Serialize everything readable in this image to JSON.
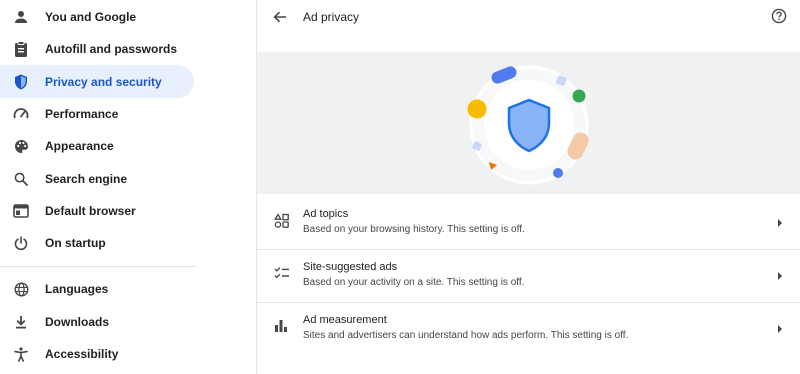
{
  "sidebar": {
    "items": [
      {
        "label": "You and Google",
        "icon": "person-icon",
        "active": false
      },
      {
        "label": "Autofill and passwords",
        "icon": "clipboard-icon",
        "active": false
      },
      {
        "label": "Privacy and security",
        "icon": "shield-icon",
        "active": true
      },
      {
        "label": "Performance",
        "icon": "speedometer-icon",
        "active": false
      },
      {
        "label": "Appearance",
        "icon": "palette-icon",
        "active": false
      },
      {
        "label": "Search engine",
        "icon": "search-icon",
        "active": false
      },
      {
        "label": "Default browser",
        "icon": "browser-window-icon",
        "active": false
      },
      {
        "label": "On startup",
        "icon": "power-icon",
        "active": false
      },
      {
        "label": "Languages",
        "icon": "globe-icon",
        "active": false
      },
      {
        "label": "Downloads",
        "icon": "download-icon",
        "active": false
      },
      {
        "label": "Accessibility",
        "icon": "accessibility-icon",
        "active": false
      }
    ]
  },
  "header": {
    "title": "Ad privacy"
  },
  "rows": [
    {
      "title": "Ad topics",
      "subtitle": "Based on your browsing history. This setting is off.",
      "icon": "ad-topics-icon"
    },
    {
      "title": "Site-suggested ads",
      "subtitle": "Based on your activity on a site. This setting is off.",
      "icon": "checklist-icon"
    },
    {
      "title": "Ad measurement",
      "subtitle": "Sites and advertisers can understand how ads perform. This setting is off.",
      "icon": "bar-chart-icon"
    }
  ],
  "colors": {
    "accent": "#1a56c7",
    "active_bg": "#e8f0fe",
    "hero_bg": "#f0f1f3",
    "shield_fill": "#8ab4f8",
    "shield_stroke": "#1a73e8"
  }
}
